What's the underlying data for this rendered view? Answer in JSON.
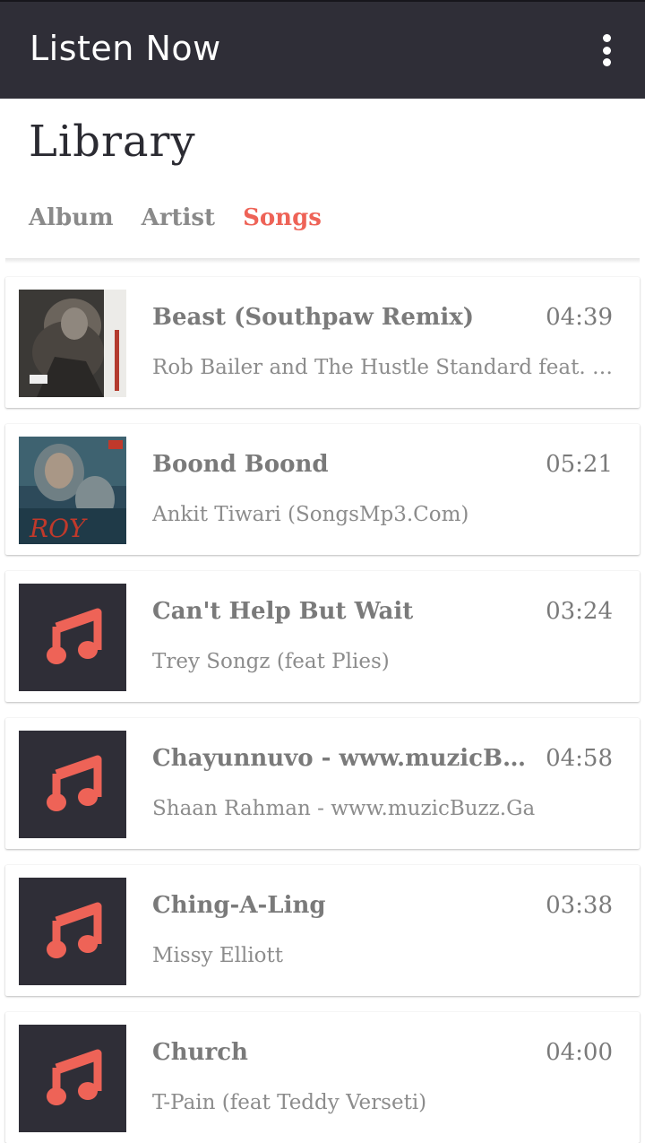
{
  "app_bar": {
    "title": "Listen Now"
  },
  "header": {
    "title": "Library",
    "tabs": [
      {
        "label": "Album",
        "active": false
      },
      {
        "label": "Artist",
        "active": false
      },
      {
        "label": "Songs",
        "active": true
      }
    ]
  },
  "colors": {
    "accent": "#ee6357",
    "app_bar": "#2f2e37",
    "note_icon": "#ee6357"
  },
  "songs": [
    {
      "title": "Beast (Southpaw Remix)",
      "artist": "Rob Bailer and The Hustle Standard feat. Busta Rhymes",
      "duration": "04:39",
      "art": "album-art-southpaw"
    },
    {
      "title": "Boond Boond",
      "artist": "Ankit Tiwari (SongsMp3.Com)",
      "duration": "05:21",
      "art": "album-art-roy"
    },
    {
      "title": "Can't Help But Wait",
      "artist": "Trey Songz (feat Plies)",
      "duration": "03:24",
      "art": "music-note-icon"
    },
    {
      "title": "Chayunnuvo - www.muzicBuzz.Ga",
      "artist": "Shaan Rahman - www.muzicBuzz.Ga",
      "duration": "04:58",
      "art": "music-note-icon"
    },
    {
      "title": "Ching-A-Ling",
      "artist": "Missy Elliott",
      "duration": "03:38",
      "art": "music-note-icon"
    },
    {
      "title": "Church",
      "artist": "T-Pain (feat Teddy Verseti)",
      "duration": "04:00",
      "art": "music-note-icon"
    }
  ]
}
